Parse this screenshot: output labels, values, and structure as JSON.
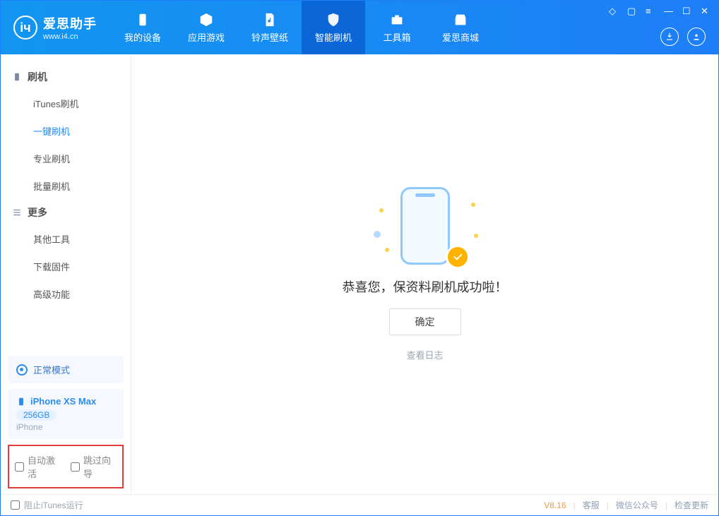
{
  "app": {
    "name": "爱思助手",
    "url": "www.i4.cn"
  },
  "nav": {
    "items": [
      {
        "label": "我的设备"
      },
      {
        "label": "应用游戏"
      },
      {
        "label": "铃声壁纸"
      },
      {
        "label": "智能刷机"
      },
      {
        "label": "工具箱"
      },
      {
        "label": "爱思商城"
      }
    ],
    "active_index": 3
  },
  "sidebar": {
    "group1": {
      "title": "刷机",
      "items": [
        {
          "label": "iTunes刷机"
        },
        {
          "label": "一键刷机"
        },
        {
          "label": "专业刷机"
        },
        {
          "label": "批量刷机"
        }
      ],
      "active_index": 1
    },
    "group2": {
      "title": "更多",
      "items": [
        {
          "label": "其他工具"
        },
        {
          "label": "下载固件"
        },
        {
          "label": "高级功能"
        }
      ]
    },
    "mode": {
      "label": "正常模式"
    },
    "device": {
      "name": "iPhone XS Max",
      "capacity": "256GB",
      "type": "iPhone"
    },
    "flags": {
      "auto_activate": "自动激活",
      "skip_guide": "跳过向导"
    }
  },
  "main": {
    "success": "恭喜您，保资料刷机成功啦！",
    "ok": "确定",
    "view_log": "查看日志"
  },
  "footer": {
    "block_itunes": "阻止iTunes运行",
    "version": "V8.16",
    "links": [
      "客服",
      "微信公众号",
      "检查更新"
    ]
  }
}
